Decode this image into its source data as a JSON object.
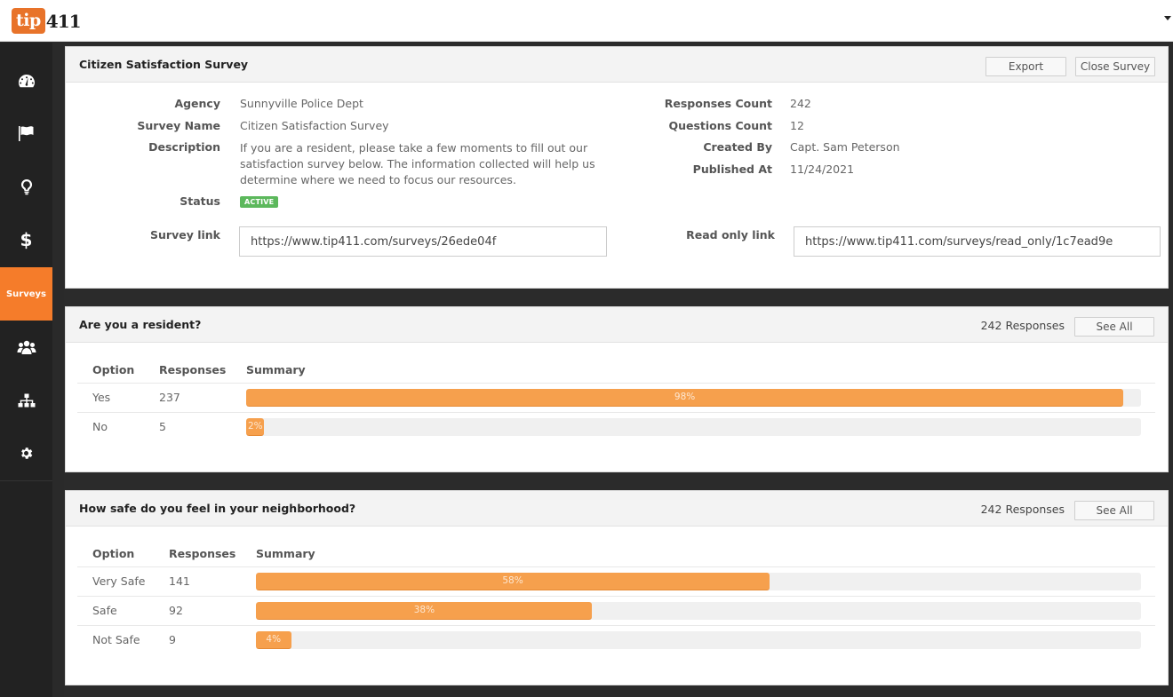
{
  "app": {
    "logo_left": "tip",
    "logo_right": "411",
    "brand_color": "#e8732a"
  },
  "sidebar": {
    "items": [
      {
        "icon": "dashboard-icon",
        "label": ""
      },
      {
        "icon": "flag-icon",
        "label": ""
      },
      {
        "icon": "lightbulb-icon",
        "label": ""
      },
      {
        "icon": "dollar-icon",
        "label": "$"
      },
      {
        "icon": "",
        "label": "Surveys",
        "active": true
      },
      {
        "icon": "users-icon",
        "label": ""
      },
      {
        "icon": "org-chart-icon",
        "label": ""
      },
      {
        "icon": "gear-icon",
        "label": ""
      }
    ],
    "active_color": "#f57c2a"
  },
  "survey": {
    "title": "Citizen Satisfaction Survey",
    "export_label": "Export",
    "close_label": "Close Survey",
    "fields": {
      "agency_label": "Agency",
      "agency": "Sunnyville Police Dept",
      "name_label": "Survey Name",
      "name": "Citizen Satisfaction Survey",
      "description_label": "Description",
      "description_lines": [
        "If you are a resident, please take a few moments to fill out our",
        "satisfaction survey below. The information collected will help us",
        "determine where we need to focus our resources."
      ],
      "status_label": "Status",
      "status": "ACTIVE",
      "responses_label": "Responses Count",
      "responses": "242",
      "questions_label": "Questions Count",
      "questions": "12",
      "created_by_label": "Created By",
      "created_by": "Capt. Sam Peterson",
      "published_label": "Published At",
      "published": "11/24/2021",
      "survey_link_label": "Survey link",
      "survey_link": "https://www.tip411.com/surveys/26ede04f",
      "readonly_link_label": "Read only link",
      "readonly_link": "https://www.tip411.com/surveys/read_only/1c7ead9e"
    }
  },
  "questions": [
    {
      "title": "Are you a resident?",
      "responses_text": "242 Responses",
      "see_all_label": "See All",
      "headers": {
        "option": "Option",
        "responses": "Responses",
        "summary": "Summary"
      },
      "rows": [
        {
          "option": "Yes",
          "count": "237",
          "percent": 98,
          "percent_label": "98%"
        },
        {
          "option": "No",
          "count": "5",
          "percent": 2,
          "percent_label": "2%"
        }
      ]
    },
    {
      "title": "How safe do you feel in your neighborhood?",
      "responses_text": "242 Responses",
      "see_all_label": "See All",
      "headers": {
        "option": "Option",
        "responses": "Responses",
        "summary": "Summary"
      },
      "rows": [
        {
          "option": "Very Safe",
          "count": "141",
          "percent": 58,
          "percent_label": "58%"
        },
        {
          "option": "Safe",
          "count": "92",
          "percent": 38,
          "percent_label": "38%"
        },
        {
          "option": "Not Safe",
          "count": "9",
          "percent": 4,
          "percent_label": "4%"
        }
      ]
    }
  ]
}
